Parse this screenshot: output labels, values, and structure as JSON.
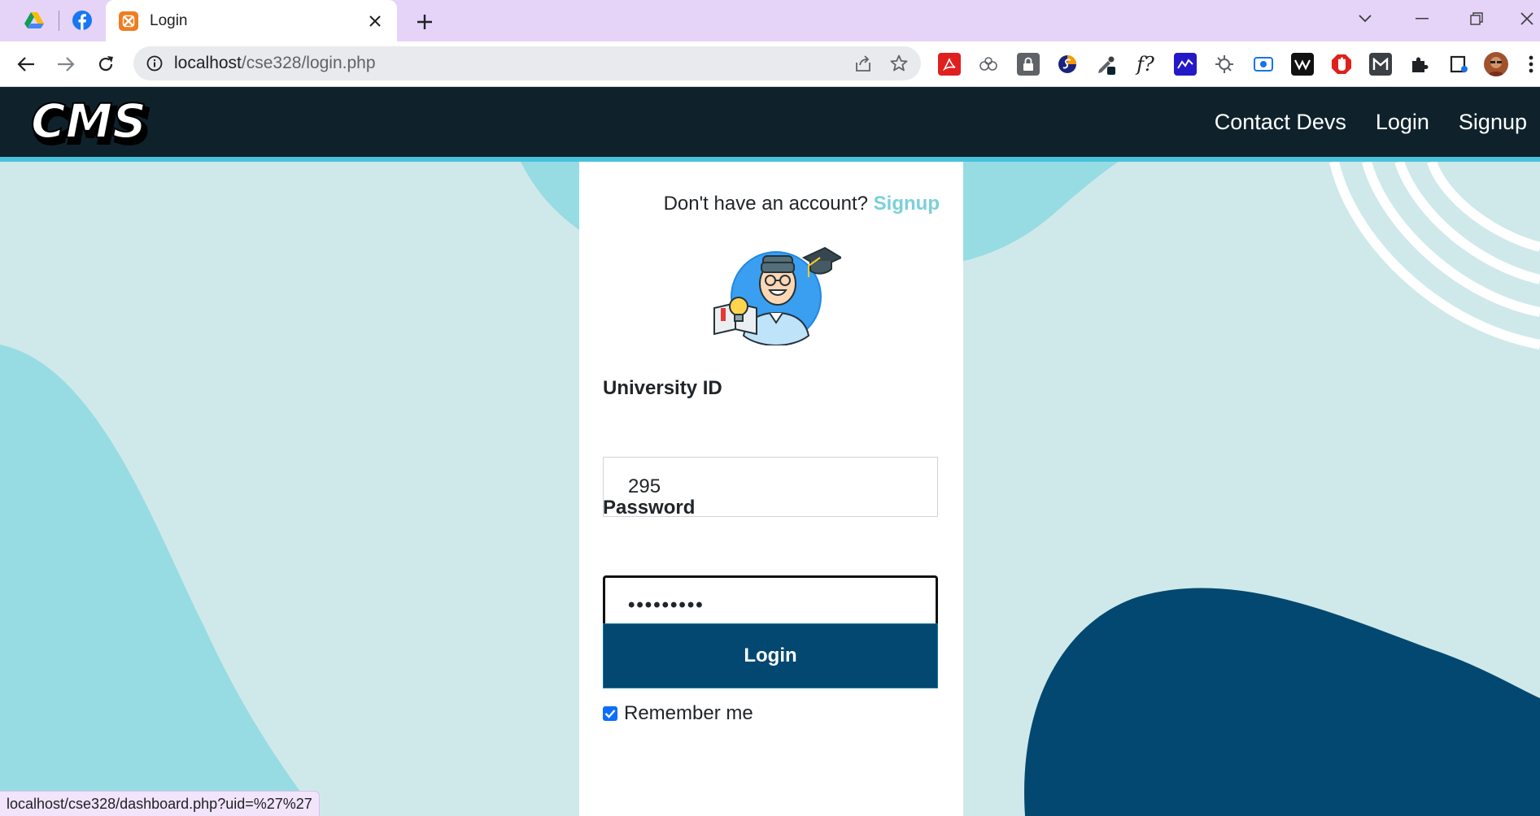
{
  "browser": {
    "tabs": [
      {
        "title": "",
        "icon": "google-drive-icon"
      },
      {
        "title": "",
        "icon": "facebook-icon"
      },
      {
        "title": "Login",
        "icon": "xampp-icon",
        "active": true
      }
    ],
    "url_host": "localhost",
    "url_path": "/cse328/login.php",
    "status_url": "localhost/cse328/dashboard.php?uid=%27%27"
  },
  "extensions": [
    "adobe-acrobat-icon",
    "sync-icon",
    "password-lock-icon",
    "extension-s-icon",
    "color-picker-icon",
    "font-finder-icon",
    "analytics-icon",
    "extension-icon",
    "screen-capture-icon",
    "wappalyzer-icon",
    "adblock-icon",
    "mailtrack-icon",
    "puzzle-icon",
    "reading-list-icon",
    "profile-avatar"
  ],
  "site": {
    "brand": "CMS",
    "nav": [
      "Contact Devs",
      "Login",
      "Signup"
    ]
  },
  "form": {
    "prompt": "Don't have an account?",
    "signup_link": "Signup",
    "uid_label": "University ID",
    "uid_value": "295",
    "password_label": "Password",
    "password_value": "•••••••••",
    "login_button": "Login",
    "remember_label": "Remember me",
    "remember_checked": true
  },
  "colors": {
    "navbar": "#0f222c",
    "accent": "#49c2dc",
    "button": "#034870",
    "blob_dark": "#034870",
    "blob_light": "#97dce2",
    "background": "#cfe9ea"
  }
}
